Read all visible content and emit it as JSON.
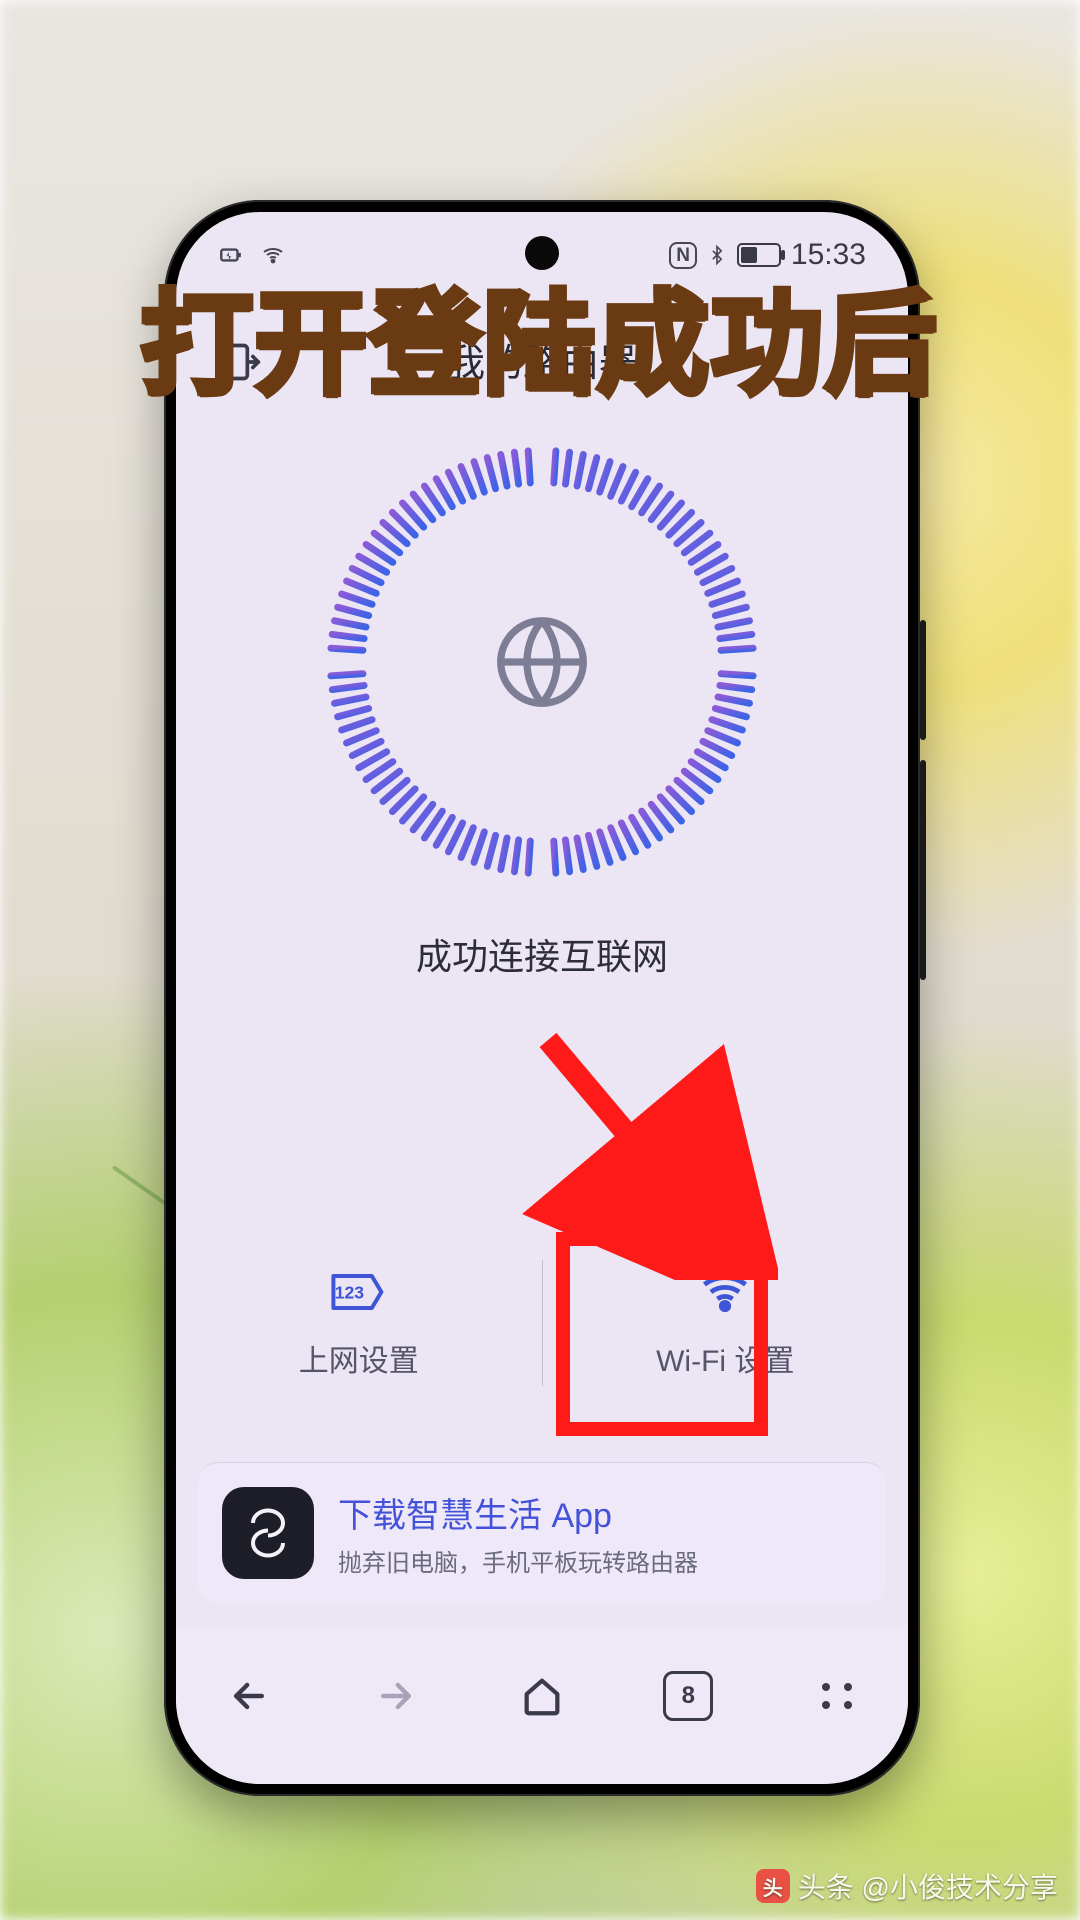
{
  "caption_overlay": "打开登陆成功后",
  "statusbar": {
    "nfc_label": "N",
    "time": "15:33"
  },
  "header": {
    "title": "我的路由器"
  },
  "connection": {
    "status_text": "成功连接互联网"
  },
  "options": {
    "internet_label": "上网设置",
    "internet_badge": "123",
    "wifi_label": "Wi-Fi 设置"
  },
  "promo": {
    "title": "下载智慧生活 App",
    "subtitle": "抛弃旧电脑，手机平板玩转路由器"
  },
  "navbar": {
    "tab_count": "8"
  },
  "watermark": {
    "logo_text": "头",
    "text": "头条 @小俊技术分享"
  }
}
